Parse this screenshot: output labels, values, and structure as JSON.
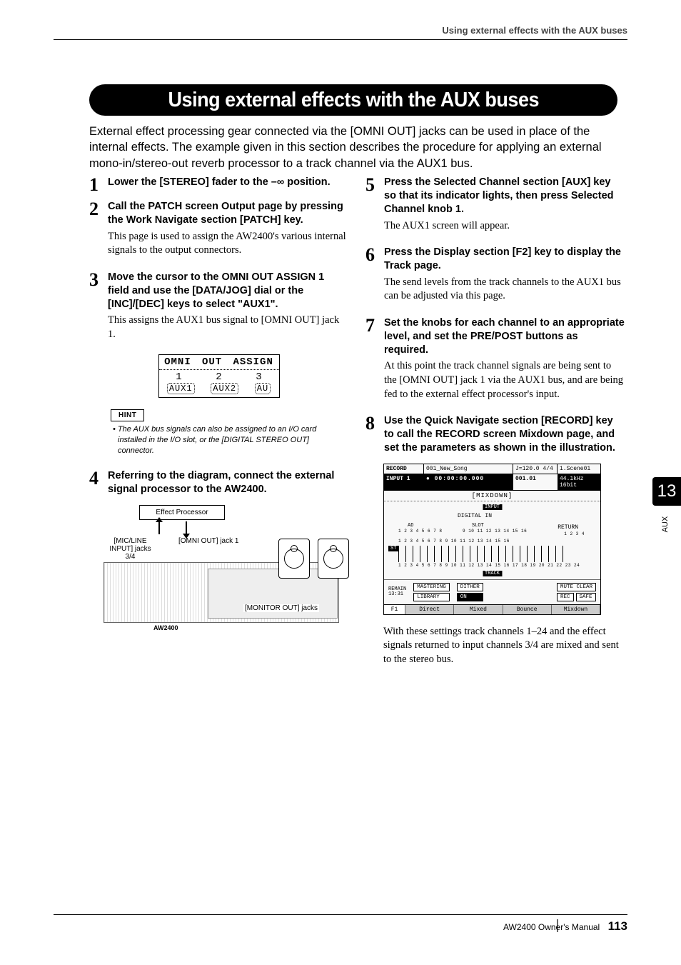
{
  "header": {
    "running_title": "Using external effects with the AUX buses"
  },
  "heading": "Using external effects with the AUX buses",
  "intro": "External effect processing gear connected via the [OMNI OUT] jacks can be used in place of the internal effects. The example given in this section describes the procedure for applying an external mono-in/stereo-out reverb processor to a track channel via the AUX1 bus.",
  "steps_left": [
    {
      "n": "1",
      "title": "Lower the [STEREO] fader to the –∞ position.",
      "desc": ""
    },
    {
      "n": "2",
      "title": "Call the PATCH screen Output page by pressing the Work Navigate section [PATCH] key.",
      "desc": "This page is used to assign the AW2400's various internal signals to the output connectors."
    },
    {
      "n": "3",
      "title": "Move the cursor to the OMNI OUT ASSIGN 1 field and use the [DATA/JOG] dial or the [INC]/[DEC] keys to select \"AUX1\".",
      "desc": "This assigns the AUX1 bus signal to [OMNI OUT] jack 1."
    }
  ],
  "lcd": {
    "header": [
      "OMNI",
      "OUT",
      "ASSIGN"
    ],
    "nums": [
      "1",
      "2",
      "3"
    ],
    "vals": [
      "AUX1",
      "AUX2",
      "AU"
    ]
  },
  "hint": {
    "label": "HINT",
    "text": "• The AUX bus signals can also be assigned to an I/O card installed in the I/O slot, or the [DIGITAL STEREO OUT] connector."
  },
  "step4": {
    "n": "4",
    "title": "Referring to the diagram, connect the external signal processor to the AW2400."
  },
  "diagram": {
    "effect_label": "Effect Processor",
    "mic_label": "[MIC/LINE INPUT] jacks 3/4",
    "omni_label": "[OMNI OUT] jack 1",
    "monitor_label": "[MONITOR OUT] jacks",
    "device": "AW2400"
  },
  "steps_right": [
    {
      "n": "5",
      "title": "Press the Selected Channel section [AUX] key so that its indicator lights, then press Selected Channel knob 1.",
      "desc": "The AUX1 screen will appear."
    },
    {
      "n": "6",
      "title": "Press the Display section [F2] key to display the Track page.",
      "desc": "The send levels from the track channels to the AUX1 bus can be adjusted via this page."
    },
    {
      "n": "7",
      "title": "Set the knobs for each channel to an appropriate level, and set the PRE/POST buttons as required.",
      "desc": "At this point the track channel signals are being sent to the [OMNI OUT] jack 1 via the AUX1 bus, and are being fed to the external effect processor's input."
    },
    {
      "n": "8",
      "title": "Use the Quick Navigate section [RECORD] key to call the RECORD screen Mixdown page, and set the parameters as shown in the illustration.",
      "desc": ""
    }
  ],
  "screenshot": {
    "top": {
      "rec": "RECORD",
      "song": "001_New_Song",
      "tempo": "J=120.0 4/4",
      "scene": "1.Scene01"
    },
    "row2": {
      "input": "INPUT 1",
      "time": "● 00:00:00.000",
      "bars": "001.01",
      "rate": "44.1kHz 16bit"
    },
    "mixdown": "MIXDOWN",
    "labels": {
      "input": "INPUT",
      "digital_in": "DIGITAL IN",
      "ad": "AD",
      "slot": "SLOT",
      "return": "RETURN",
      "st": "ST",
      "track": "TRACK"
    },
    "nums": {
      "ad": "1 2 3 4 5 6 7 8",
      "slot": "9 10 11 12 13 14 15 16",
      "return": "1  2  3  4",
      "ad2": "1 2 3 4 5 6 7 8 9 10 11 12 13 14 15 16",
      "track": "1 2 3 4 5 6 7 8 9 10 11 12 13 14 15 16 17 18 19 20 21 22 23 24"
    },
    "buttons": {
      "mastering": "MASTERING",
      "library": "LIBRARY",
      "dither": "DITHER",
      "on": "ON",
      "mute_clear": "MUTE CLEAR",
      "rec": "REC",
      "safe": "SAFE"
    },
    "remain": {
      "label": "REMAIN",
      "time": "13:31"
    },
    "tabs": {
      "f1": "F1",
      "direct": "Direct",
      "mixed": "Mixed",
      "bounce": "Bounce",
      "mixdown": "Mixdown"
    }
  },
  "closing": "With these settings track channels 1–24 and the effect signals returned to input channels 3/4 are mixed and sent to the stereo bus.",
  "sidetab": {
    "num": "13",
    "label": "AUX"
  },
  "footer": {
    "manual": "AW2400  Owner's Manual",
    "page": "113"
  }
}
